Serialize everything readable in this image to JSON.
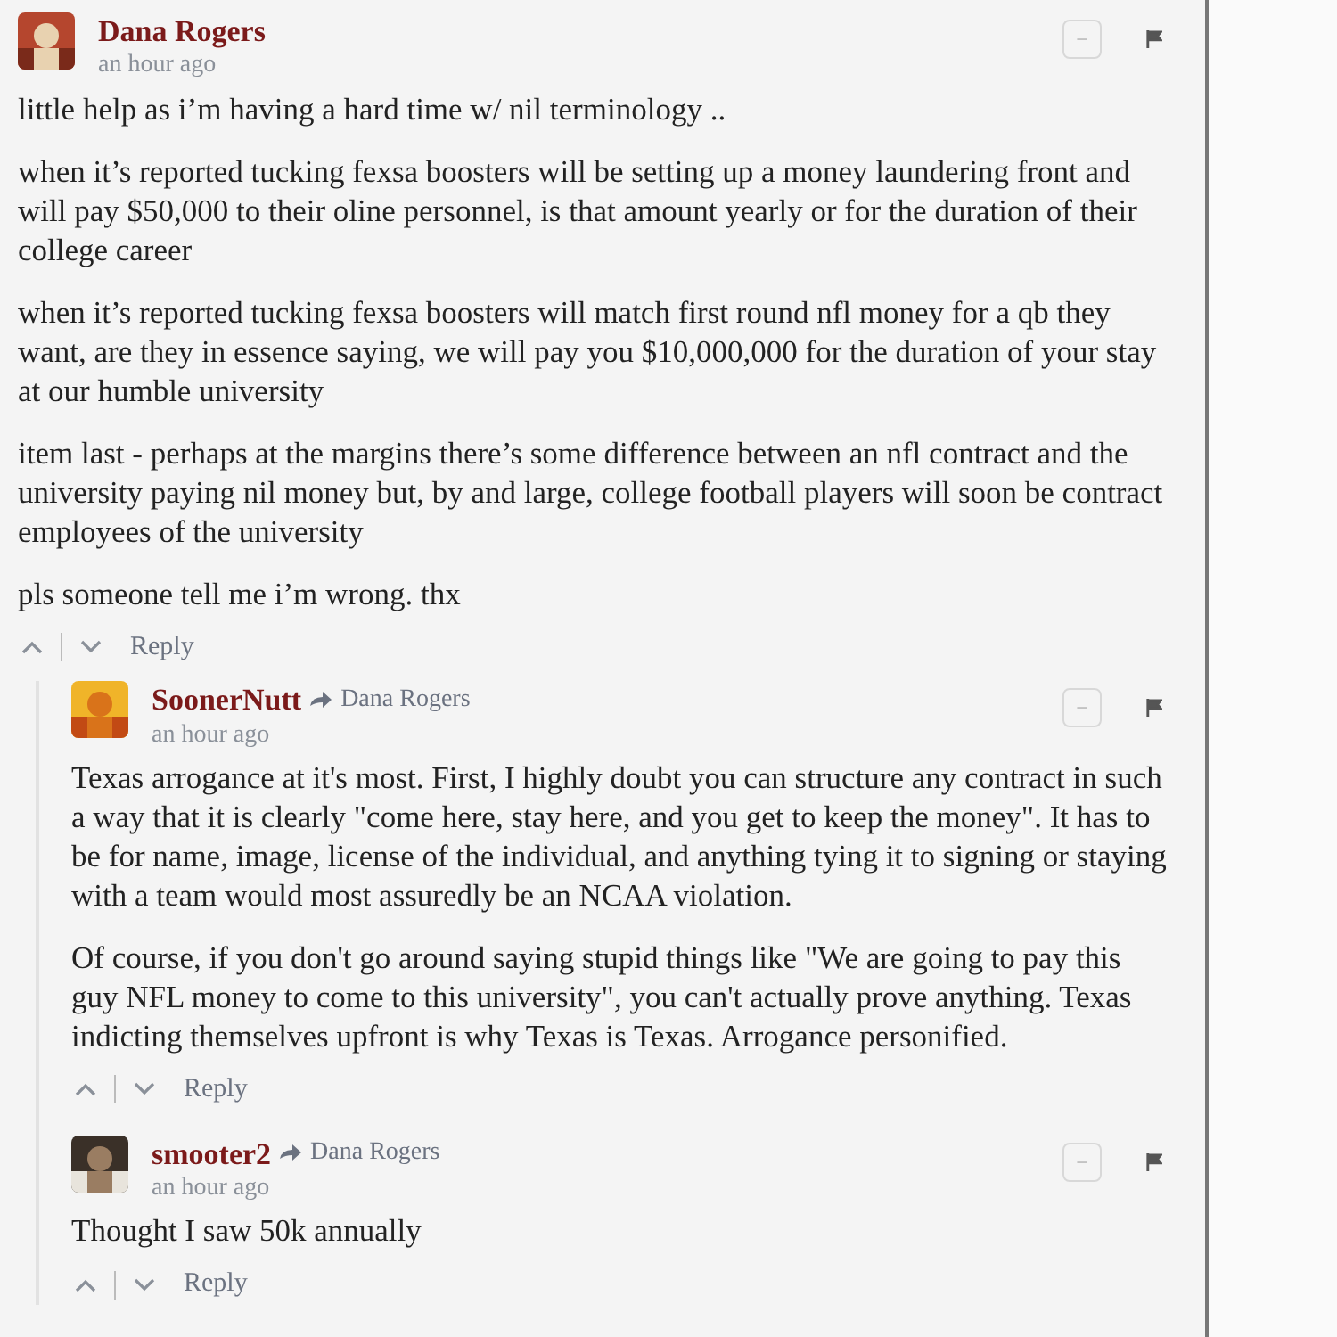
{
  "comments": [
    {
      "author": "Dana Rogers",
      "time": "an hour ago",
      "avatar": {
        "kind": "picture"
      },
      "collapse": "−",
      "paragraphs": [
        "little help as i’m having a hard time w/ nil terminology ..",
        "when it’s reported tucking fexsa boosters will be setting up a money laundering front and will pay $50,000 to their oline personnel, is that amount yearly or for the duration of their college career",
        "when it’s reported tucking fexsa boosters will match first round nfl money for a qb they want, are they in essence saying, we will pay you $10,000,000 for the duration of your stay at our humble university",
        "item last - perhaps at the margins there’s some difference between an nfl contract and the university paying nil money but, by and large, college football players will soon be contract employees of the university",
        "pls someone tell me i’m wrong. thx"
      ],
      "reply": "Reply",
      "children": [
        {
          "author": "SoonerNutt",
          "reply_to": "Dana Rogers",
          "time": "an hour ago",
          "avatar": {
            "kind": "picture"
          },
          "collapse": "−",
          "paragraphs": [
            "Texas arrogance at it's most. First, I highly doubt you can structure any contract in such a way that it is clearly \"come here, stay here, and you get to keep the money\". It has to be for name, image, license of the individual, and anything tying it to signing or staying with a team would most assuredly be an NCAA violation.",
            "Of course, if you don't go around saying stupid things like \"We are going to pay this guy NFL money to come to this university\", you can't actually prove anything. Texas indicting themselves upfront is why Texas is Texas. Arrogance personified."
          ],
          "reply": "Reply"
        },
        {
          "author": "smooter2",
          "reply_to": "Dana Rogers",
          "time": "an hour ago",
          "avatar": {
            "kind": "picture"
          },
          "collapse": "−",
          "paragraphs": [
            "Thought I saw 50k annually"
          ],
          "reply": "Reply"
        }
      ]
    }
  ]
}
